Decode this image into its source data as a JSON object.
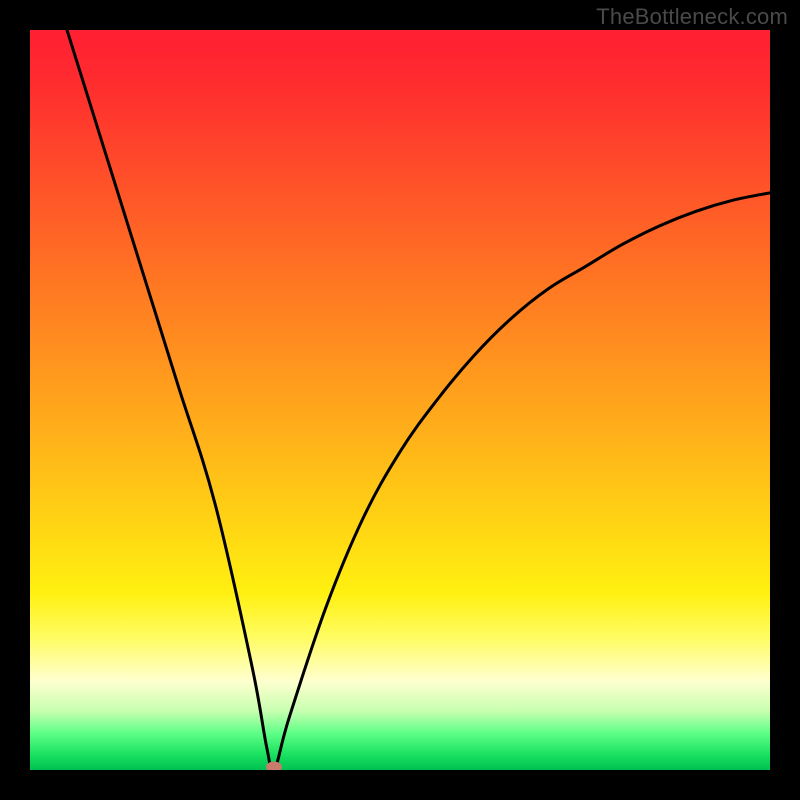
{
  "watermark": "TheBottleneck.com",
  "chart_data": {
    "type": "line",
    "title": "",
    "xlabel": "",
    "ylabel": "",
    "xlim": [
      0,
      100
    ],
    "ylim": [
      0,
      100
    ],
    "series": [
      {
        "name": "bottleneck-curve",
        "x": [
          5,
          10,
          15,
          20,
          25,
          30,
          32,
          33,
          35,
          40,
          45,
          50,
          55,
          60,
          65,
          70,
          75,
          80,
          85,
          90,
          95,
          100
        ],
        "values": [
          100,
          84,
          68,
          52,
          36,
          14,
          3,
          0,
          7,
          22,
          34,
          43,
          50,
          56,
          61,
          65,
          68,
          71,
          73.5,
          75.5,
          77,
          78
        ]
      }
    ],
    "minimum_point": {
      "x": 33,
      "y": 0
    },
    "grid": false
  },
  "colors": {
    "curve": "#000000",
    "marker": "#c97b6e",
    "frame": "#000000"
  }
}
